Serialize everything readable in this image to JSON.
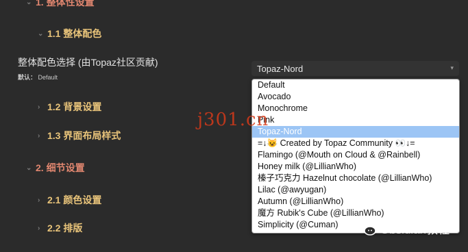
{
  "headings": {
    "h1_overall": "1. 整体性设置",
    "h2_color": "1.1 整体配色",
    "h2_bg": "1.2 背景设置",
    "h2_layout": "1.3 界面布局样式",
    "h1_detail": "2. 细节设置",
    "h2_colors": "2.1 颜色设置",
    "h2_typeset": "2.2 排版"
  },
  "setting": {
    "name": "整体配色选择 (由Topaz社区贡献)",
    "default_label": "默认：",
    "default_value": "Default"
  },
  "select": {
    "value": "Topaz-Nord",
    "arrow": "▾"
  },
  "dropdown": {
    "options": [
      "Default",
      "Avocado",
      "Monochrome",
      "Pink",
      "Topaz-Nord",
      "=↓😺 Created by Topaz Community 👀↓=",
      "Flamingo (@Mouth on Cloud & @Rainbell)",
      "Honey milk (@LillianWho)",
      "榛子巧克力 Hazelnut chocolate (@LillianWho)",
      "Lilac (@awyugan)",
      "Autumn (@LillianWho)",
      "魔方 Rubik's Cube (@LillianWho)",
      "Simplicity (@Cuman)"
    ],
    "selected_index": 4
  },
  "watermarks": {
    "red_text": "j301.cn",
    "badge_text": "Obsidian教程"
  },
  "colors": {
    "background": "#2b2b2b",
    "h1": "#e0866f",
    "h2": "#e9c47a",
    "selected_option": "#9cc5f5"
  }
}
